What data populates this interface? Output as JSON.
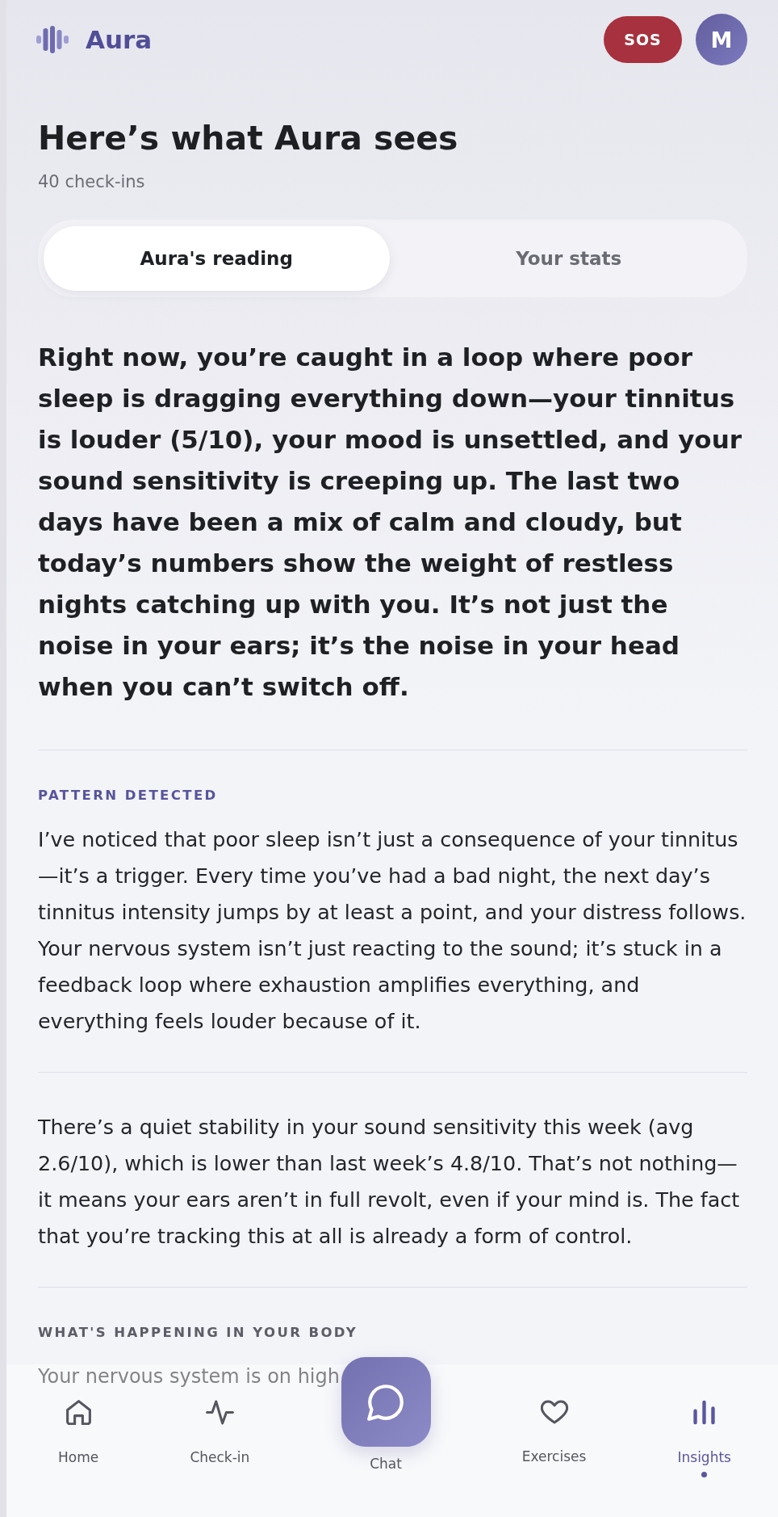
{
  "header": {
    "app_name": "Aura",
    "sos_label": "SOS",
    "avatar_initial": "M"
  },
  "page": {
    "title": "Here’s what Aura sees",
    "subtitle": "40 check-ins"
  },
  "tabs": [
    {
      "label": "Aura's reading",
      "selected": true
    },
    {
      "label": "Your stats",
      "selected": false
    }
  ],
  "summary": "Right now, you’re caught in a loop where poor sleep is dragging everything down—your tinnitus is louder (5/10), your mood is unsettled, and your sound sensitivity is creeping up. The last two days have been a mix of calm and cloudy, but today’s numbers show the weight of restless nights catching up with you. It’s not just the noise in your ears; it’s the noise in your head when you can’t switch off.",
  "sections": [
    {
      "kind": "pattern",
      "heading": "PATTERN DETECTED",
      "body": "I’ve noticed that poor sleep isn’t just a consequence of your tinnitus—it’s a trigger. Every time you’ve had a bad night, the next day’s tinnitus intensity jumps by at least a point, and your distress follows. Your nervous system isn’t just reacting to the sound; it’s stuck in a feedback loop where exhaustion amplifies everything, and everything feels louder because of it."
    },
    {
      "kind": "note",
      "body": "There’s a quiet stability in your sound sensitivity this week (avg 2.6/10), which is lower than last week’s 4.8/10. That’s not nothing—it means your ears aren’t in full revolt, even if your mind is. The fact that you’re tracking this at all is already a form of control."
    },
    {
      "kind": "explainer",
      "heading": "WHAT'S HAPPENING IN YOUR BODY",
      "body": "Your nervous system is on high"
    }
  ],
  "bottom_nav": [
    {
      "label": "Home",
      "kind": "tab",
      "selected": false
    },
    {
      "label": "Check-in",
      "kind": "tab",
      "selected": false
    },
    {
      "label": "Chat",
      "kind": "action",
      "selected": false
    },
    {
      "label": "Exercises",
      "kind": "tab",
      "selected": false
    },
    {
      "label": "Insights",
      "kind": "tab",
      "selected": true
    }
  ]
}
